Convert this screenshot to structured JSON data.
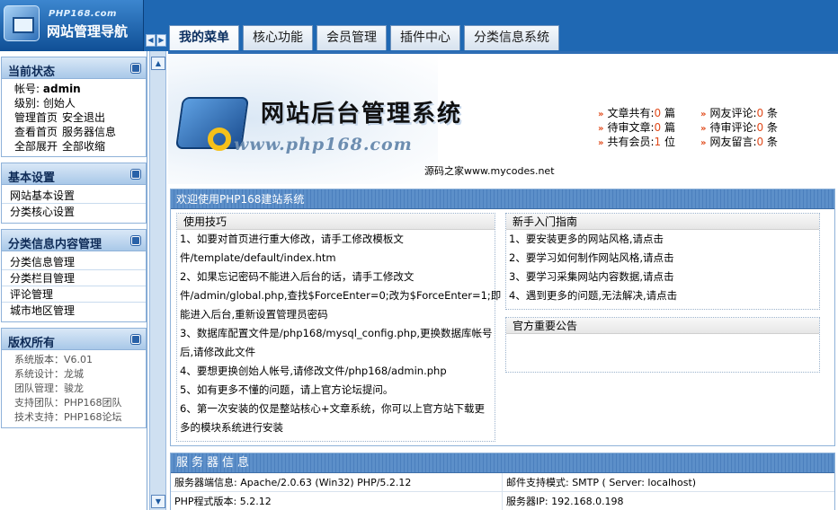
{
  "logo": {
    "site": "PHP168.com",
    "title": "网站管理导航"
  },
  "tabs": [
    "我的菜单",
    "核心功能",
    "会员管理",
    "插件中心",
    "分类信息系统"
  ],
  "sidebar": {
    "status": {
      "title": "当前状态",
      "account_label": "帐号:",
      "account_value": "admin",
      "level_label": "级别:",
      "level_value": "创始人",
      "links": [
        [
          "管理首页",
          "安全退出"
        ],
        [
          "查看首页",
          "服务器信息"
        ],
        [
          "全部展开",
          "全部收缩"
        ]
      ]
    },
    "basic": {
      "title": "基本设置",
      "items": [
        "网站基本设置",
        "分类核心设置"
      ]
    },
    "content": {
      "title": "分类信息内容管理",
      "items": [
        "分类信息管理",
        "分类栏目管理",
        "评论管理",
        "城市地区管理"
      ]
    },
    "copyright": {
      "title": "版权所有",
      "lines": [
        "系统版本：V6.01",
        "系统设计：龙城",
        "团队管理：骏龙",
        "支持团队：PHP168团队",
        "技术支持：PHP168论坛"
      ]
    }
  },
  "banner": {
    "title": "网站后台管理系统",
    "url": "www.php168.com",
    "source": "源码之家www.mycodes.net"
  },
  "stats": [
    [
      {
        "label": "文章共有:",
        "value": "0",
        "unit": "篇"
      },
      {
        "label": "网友评论:",
        "value": "0",
        "unit": "条"
      }
    ],
    [
      {
        "label": "待审文章:",
        "value": "0",
        "unit": "篇"
      },
      {
        "label": "待审评论:",
        "value": "0",
        "unit": "条"
      }
    ],
    [
      {
        "label": "共有会员:",
        "value": "1",
        "unit": "位"
      },
      {
        "label": "网友留言:",
        "value": "0",
        "unit": "条"
      }
    ]
  ],
  "welcome": {
    "title": "欢迎使用PHP168建站系统",
    "tips_title": "使用技巧",
    "tips": [
      "1、如要对首页进行重大修改，请手工修改模板文",
      "件/template/default/index.htm",
      "2、如果忘记密码不能进入后台的话，请手工修改文",
      "件/admin/global.php,查找$ForceEnter=0;改为$ForceEnter=1;即",
      "能进入后台,重新设置管理员密码",
      "3、数据库配置文件是/php168/mysql_config.php,更换数据库帐号",
      "后,请修改此文件",
      "4、要想更换创始人帐号,请修改文件/php168/admin.php",
      "5、如有更多不懂的问题，请上官方论坛提问。",
      "6、第一次安装的仅是整站核心+文章系统，你可以上官方站下载更",
      "多的模块系统进行安装"
    ],
    "guide_title": "新手入门指南",
    "guide": [
      "1、要安装更多的网站风格,请点击",
      "2、要学习如何制作网站风格,请点击",
      "3、要学习采集网站内容数据,请点击",
      "4、遇到更多的问题,无法解决,请点击"
    ],
    "notice_title": "官方重要公告"
  },
  "server": {
    "title": "服务器信息",
    "rows": [
      [
        "服务器端信息:  Apache/2.0.63 (Win32) PHP/5.2.12",
        "邮件支持模式:  SMTP ( Server: localhost)"
      ],
      [
        "PHP程式版本:  5.2.12",
        "服务器IP:  192.168.0.198"
      ]
    ]
  },
  "icons": {
    "stat_bullet": "double-chevron-icon",
    "collapse": "collapse-square-icon"
  },
  "colors": {
    "accent": "#1f68b3",
    "highlight": "#e04a1b"
  }
}
